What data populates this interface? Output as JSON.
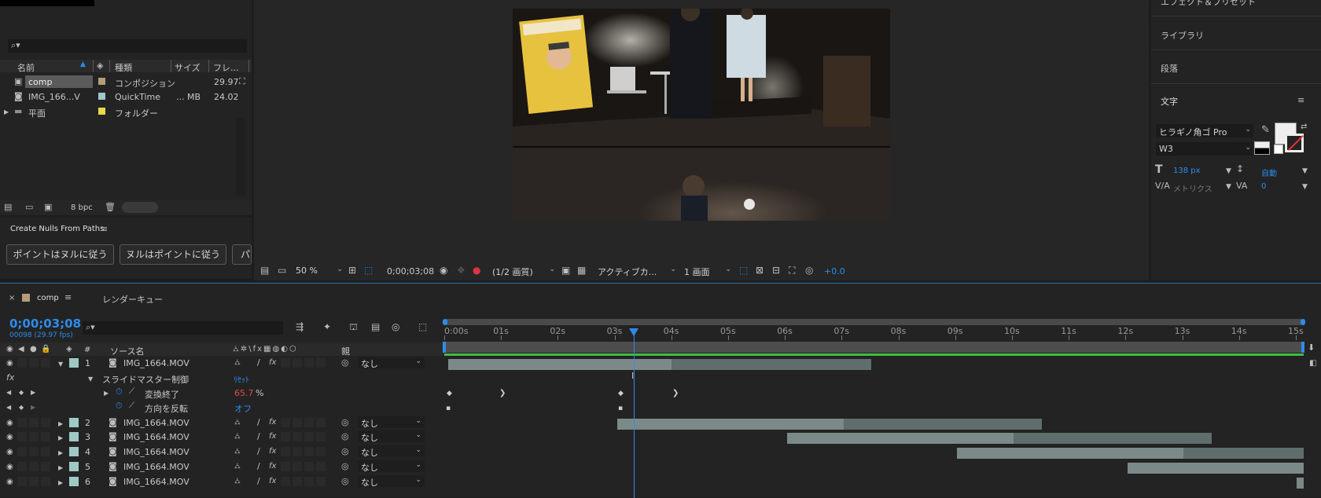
{
  "project": {
    "search_placeholder": "",
    "columns": {
      "name": "名前",
      "type": "種類",
      "size": "サイズ",
      "frame": "フレ..."
    },
    "items": [
      {
        "name": "comp",
        "type": "コンポジション",
        "size": "",
        "frame": "29.97",
        "swatch": "#b59d7a",
        "icon": "composition-icon",
        "selected": true
      },
      {
        "name": "IMG_166...V",
        "type": "QuickTime",
        "size": "... MB",
        "frame": "24.02",
        "swatch": "#9ec9c4",
        "icon": "footage-icon",
        "selected": false
      },
      {
        "name": "平面",
        "type": "フォルダー",
        "size": "",
        "frame": "",
        "swatch": "#e6d94a",
        "icon": "folder-icon",
        "selected": false
      }
    ],
    "bpc": "8 bpc"
  },
  "nulls_panel": {
    "title": "Create Nulls From Paths",
    "btn1": "ポイントはヌルに従う",
    "btn2": "ヌルはポイントに従う",
    "btn3": "パ"
  },
  "viewer": {
    "zoom": "50 %",
    "timecode": "0;00;03;08",
    "resolution": "(1/2 画質)",
    "camera": "アクティブカ...",
    "views": "1 画面",
    "exposure": "+0.0"
  },
  "right_panel": {
    "effects": "エフェクト＆プリセット",
    "library": "ライブラリ",
    "paragraph": "段落",
    "character": "文字",
    "font_family": "ヒラギノ角ゴ Pro",
    "font_style": "W3",
    "font_size": "138 px",
    "leading": "自動",
    "kerning": "メトリクス",
    "tracking": "0"
  },
  "timeline": {
    "tab_comp": "comp",
    "tab_render": "レンダーキュー",
    "timecode": "0;00;03;08",
    "frame_info": "00098 (29.97 fps)",
    "search_placeholder": "",
    "col_num": "#",
    "col_source": "ソース名",
    "col_parent": "親",
    "ruler": [
      "0:00s",
      "01s",
      "02s",
      "03s",
      "04s",
      "05s",
      "06s",
      "07s",
      "08s",
      "09s",
      "10s",
      "11s",
      "12s",
      "13s",
      "14s",
      "15s"
    ],
    "layers": [
      {
        "num": "1",
        "name": "IMG_1664.MOV",
        "parent": "なし",
        "expanded": true
      },
      {
        "num": "2",
        "name": "IMG_1664.MOV",
        "parent": "なし",
        "expanded": false
      },
      {
        "num": "3",
        "name": "IMG_1664.MOV",
        "parent": "なし",
        "expanded": false
      },
      {
        "num": "4",
        "name": "IMG_1664.MOV",
        "parent": "なし",
        "expanded": false
      },
      {
        "num": "5",
        "name": "IMG_1664.MOV",
        "parent": "なし",
        "expanded": false
      },
      {
        "num": "6",
        "name": "IMG_1664.MOV",
        "parent": "なし",
        "expanded": false
      }
    ],
    "effect_name": "スライドマスター制御",
    "effect_reset": "ﾘｾｯﾄ",
    "prop1_name": "変換終了",
    "prop1_value": "65.7",
    "prop1_unit": "%",
    "prop2_name": "方向を反転",
    "prop2_value": "オフ",
    "fx_label": "fx"
  },
  "colors": {
    "accent": "#2d8ceb",
    "value_red": "#e24b4b",
    "green_bar": "#3fbf3f",
    "layer_bar": "#5f6e6c",
    "layer_bar_active": "#7b8a88"
  }
}
